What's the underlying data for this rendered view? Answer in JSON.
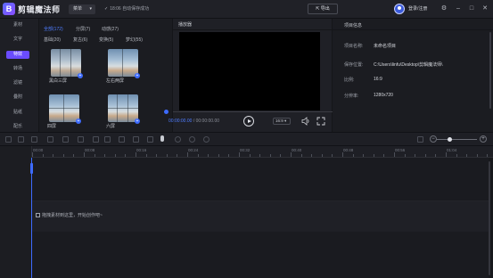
{
  "app": {
    "name": "剪辑魔法师",
    "logo_letter": "B"
  },
  "titlebar": {
    "menu_label": "菜单",
    "save_status": "18:06 自动保存成功",
    "export_label": "导出",
    "login_label": "登录/注册"
  },
  "nav": {
    "items": [
      "素材",
      "文字",
      "特效",
      "转场",
      "滤镜",
      "叠附",
      "贴纸",
      "配乐"
    ],
    "active_index": 2
  },
  "media": {
    "tabs_row1": [
      "全部(172)",
      "分屏(7)",
      "动感(27)"
    ],
    "tabs_row2": [
      "基础(20)",
      "复古(6)",
      "变换(5)",
      "梦幻(55)"
    ],
    "active_tab": "全部(172)",
    "items": [
      {
        "label": "黑白三屏",
        "badge": "+"
      },
      {
        "label": "左右两屏",
        "badge": "+"
      },
      {
        "label": "四屏",
        "badge": "+"
      },
      {
        "label": "六屏",
        "badge": "+"
      }
    ]
  },
  "player": {
    "title": "播放器",
    "current_time": "00:00:00.00",
    "total_time": "00:00:00.00",
    "time_separator": "/",
    "ratio": "16:9"
  },
  "project": {
    "title": "项目信息",
    "fields": [
      {
        "label": "项目名称:",
        "value": "未命名项目"
      },
      {
        "label": "保存位置:",
        "value": "C:\\Users\\linfu\\Desktop\\剪辑魔法师\\"
      },
      {
        "label": "比例:",
        "value": "16:9"
      },
      {
        "label": "分辨率:",
        "value": "1280x720"
      }
    ]
  },
  "timeline": {
    "ticks": [
      "00:00",
      "00:08",
      "00:16",
      "00:24",
      "00:32",
      "00:40",
      "00:48",
      "00:56",
      "01:04"
    ],
    "drop_hint": "拖拽素材到这里，开始创作吧~",
    "zoom_level": 0.33
  },
  "icons": {
    "volume": "volume-icon",
    "fullscreen": "fullscreen-icon",
    "play": "play-icon",
    "microphone": "microphone-icon"
  },
  "colors": {
    "accent": "#3d6bff",
    "active_nav": "#6a4cff",
    "background": "#1b1c21"
  }
}
